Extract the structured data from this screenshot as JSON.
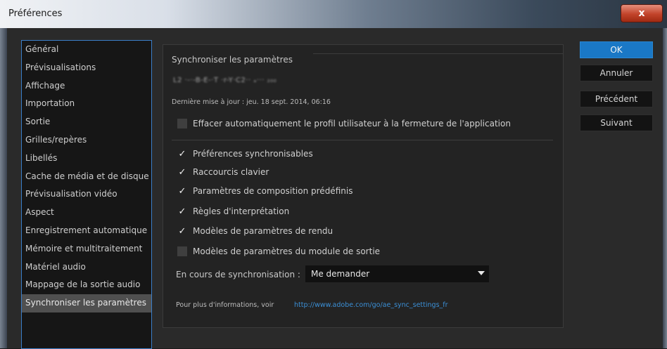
{
  "window": {
    "title": "Préférences",
    "close_label": "x"
  },
  "sidebar": {
    "items": [
      {
        "label": "Général"
      },
      {
        "label": "Prévisualisations"
      },
      {
        "label": "Affichage"
      },
      {
        "label": "Importation"
      },
      {
        "label": "Sortie"
      },
      {
        "label": "Grilles/repères"
      },
      {
        "label": "Libellés"
      },
      {
        "label": "Cache de média et de disque"
      },
      {
        "label": "Prévisualisation vidéo"
      },
      {
        "label": "Aspect"
      },
      {
        "label": "Enregistrement automatique"
      },
      {
        "label": "Mémoire et multitraitement"
      },
      {
        "label": "Matériel audio"
      },
      {
        "label": "Mappage de la sortie audio"
      },
      {
        "label": "Synchroniser les paramètres"
      }
    ],
    "selected_index": 14
  },
  "panel": {
    "section_title": "Synchroniser les paramètres",
    "account_text": "L2 ·-·-B-E-·T ·r-Y·C2·· ₐ··· ₂₀₀",
    "last_update": "Dernière mise à jour : jeu. 18 sept. 2014, 06:16",
    "clear_profile": {
      "label": "Effacer automatiquement le profil utilisateur à la fermeture de l'application",
      "checked": false
    },
    "options": [
      {
        "label": "Préférences synchronisables",
        "checked": true
      },
      {
        "label": "Raccourcis clavier",
        "checked": true
      },
      {
        "label": "Paramètres de composition prédéfinis",
        "checked": true
      },
      {
        "label": "Règles d'interprétation",
        "checked": true
      },
      {
        "label": "Modèles de paramètres de rendu",
        "checked": true
      },
      {
        "label": "Modèles de paramètres du module de sortie",
        "checked": false
      }
    ],
    "sync_label": "En cours de synchronisation :",
    "sync_value": "Me demander",
    "info_label": "Pour plus d'informations, voir",
    "info_link": "http://www.adobe.com/go/ae_sync_settings_fr",
    "check_glyph": "✓"
  },
  "buttons": {
    "ok": "OK",
    "cancel": "Annuler",
    "previous": "Précédent",
    "next": "Suivant"
  },
  "colors": {
    "accent": "#1a78c6",
    "link": "#3b8fd6",
    "selection": "#4f4f4f"
  }
}
